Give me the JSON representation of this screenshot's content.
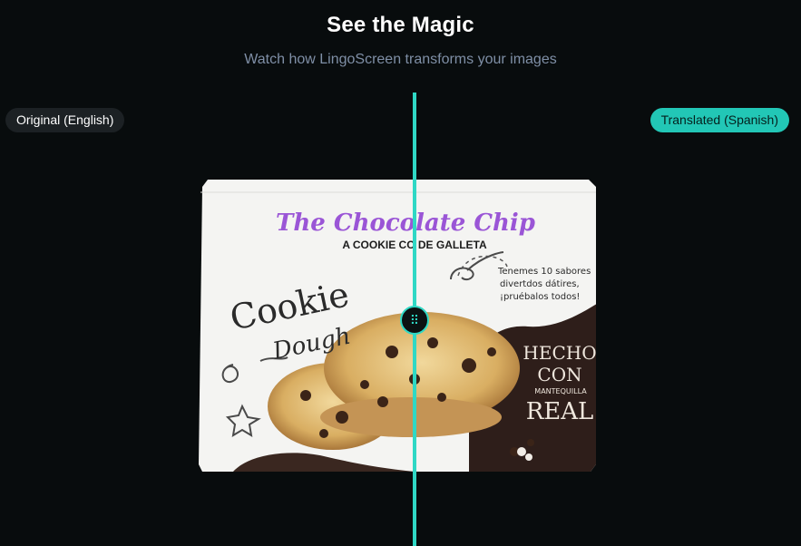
{
  "header": {
    "title": "See the Magic",
    "subtitle": "Watch how LingoScreen transforms your images"
  },
  "labels": {
    "original": "Original (English)",
    "translated": "Translated (Spanish)"
  },
  "handle": {
    "icon": "grip-dots-icon"
  },
  "product": {
    "brand_name": "The Chocolate Chip",
    "tagline": "A COOKIE CO DE GALLETA",
    "flavor_line1": "Cookie",
    "flavor_line2": "Dough",
    "promo_line1": "Tenemes 10 sabores",
    "promo_line2": "divertdos dátires,",
    "promo_line3": "¡pruébalos todos!",
    "badge_line1": "HECHO",
    "badge_line2": "CON",
    "badge_line3": "MANTEQUILLA",
    "badge_line4": "REAL"
  },
  "colors": {
    "accent": "#2fd8c5",
    "brand_purple": "#9a55d6",
    "background": "#080c0d"
  }
}
